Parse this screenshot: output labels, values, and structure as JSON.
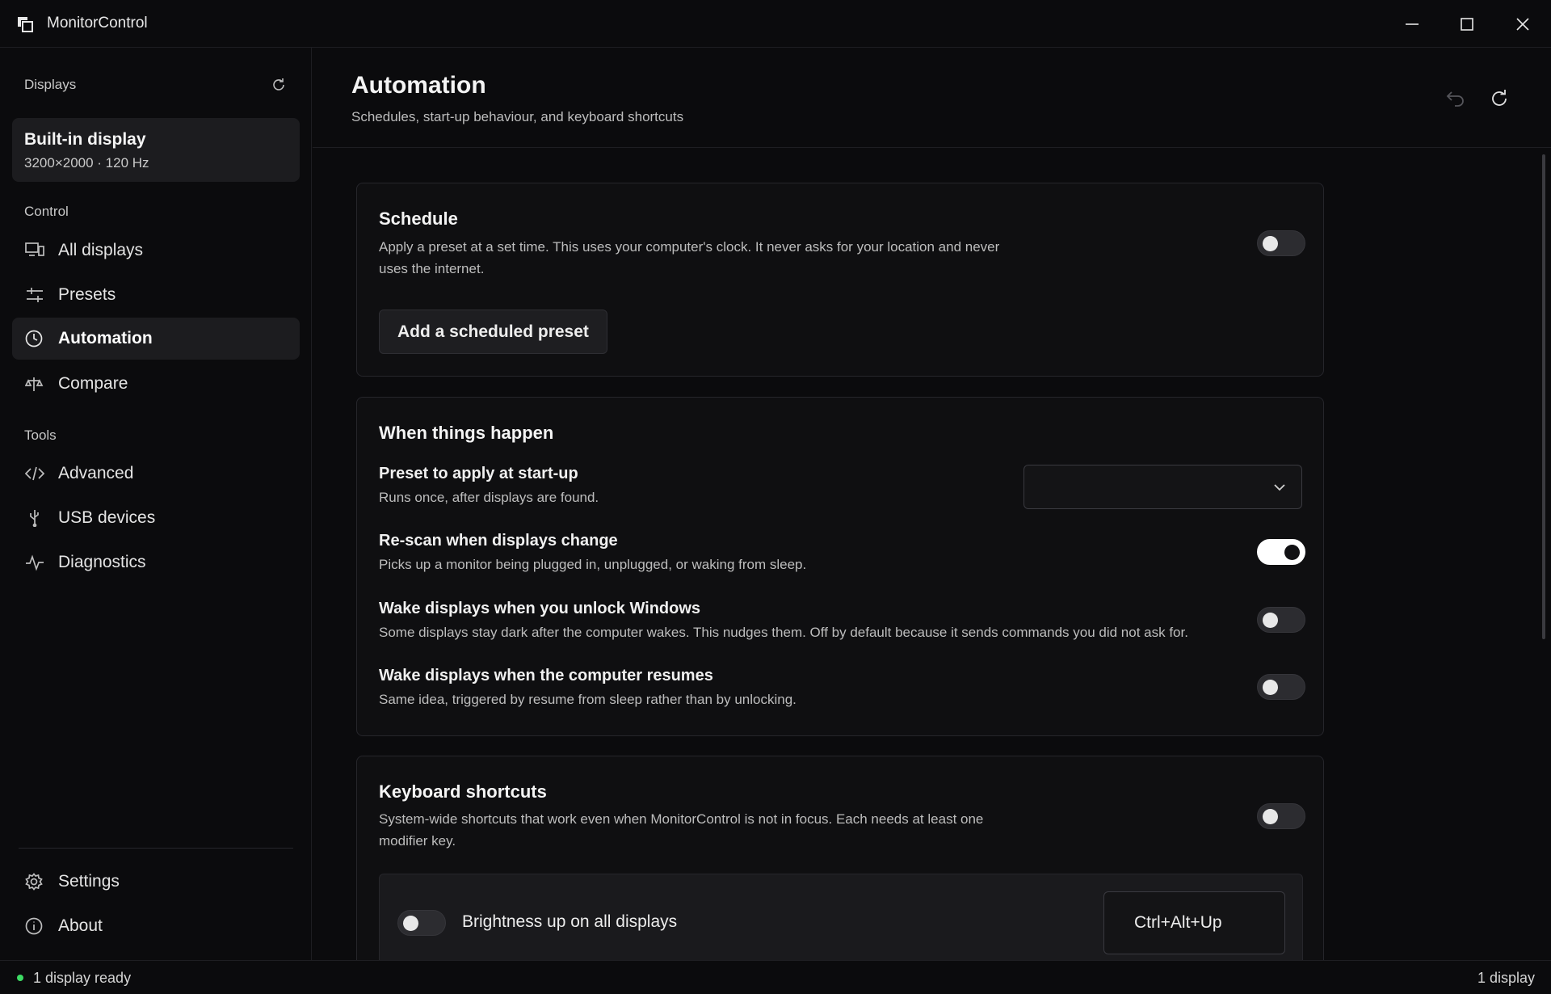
{
  "window": {
    "title": "MonitorControl"
  },
  "sidebar": {
    "displays_heading": "Displays",
    "display": {
      "name": "Built-in display",
      "spec": "3200×2000  ·  120 Hz"
    },
    "control_heading": "Control",
    "control_items": [
      {
        "label": "All displays",
        "icon": "monitors-icon"
      },
      {
        "label": "Presets",
        "icon": "sliders-icon"
      },
      {
        "label": "Automation",
        "icon": "clock-icon",
        "active": true
      },
      {
        "label": "Compare",
        "icon": "scale-icon"
      }
    ],
    "tools_heading": "Tools",
    "tools_items": [
      {
        "label": "Advanced",
        "icon": "code-icon"
      },
      {
        "label": "USB devices",
        "icon": "usb-icon"
      },
      {
        "label": "Diagnostics",
        "icon": "pulse-icon"
      }
    ],
    "footer_items": [
      {
        "label": "Settings",
        "icon": "gear-icon"
      },
      {
        "label": "About",
        "icon": "info-icon"
      }
    ]
  },
  "header": {
    "title": "Automation",
    "subtitle": "Schedules, start-up behaviour, and keyboard shortcuts"
  },
  "schedule": {
    "title": "Schedule",
    "description_line1": "Apply a preset at a set time. This uses your computer's clock. It never asks for your location and never",
    "description_line2": "uses the internet.",
    "enabled": false,
    "add_button": "Add a scheduled preset"
  },
  "events": {
    "title": "When things happen",
    "startup_preset": {
      "title": "Preset to apply at start-up",
      "description": "Runs once, after displays are found.",
      "value": ""
    },
    "rescan": {
      "title": "Re-scan when displays change",
      "description": "Picks up a monitor being plugged in, unplugged, or waking from sleep.",
      "enabled": true
    },
    "wake_unlock": {
      "title": "Wake displays when you unlock Windows",
      "description": "Some displays stay dark after the computer wakes. This nudges them. Off by default because it sends commands you did not ask for.",
      "enabled": false
    },
    "wake_resume": {
      "title": "Wake displays when the computer resumes",
      "description": "Same idea, triggered by resume from sleep rather than by unlocking.",
      "enabled": false
    }
  },
  "shortcuts": {
    "title": "Keyboard shortcuts",
    "description_line1": "System-wide shortcuts that work even when MonitorControl is not in focus. Each needs at least one",
    "description_line2": "modifier key.",
    "enabled": false,
    "items": [
      {
        "label": "Brightness up on all displays",
        "keys": "Ctrl+Alt+Up",
        "enabled": false
      }
    ]
  },
  "status": {
    "left": "1 display ready",
    "right": "1 display",
    "indicator_color": "#3ddc64"
  }
}
